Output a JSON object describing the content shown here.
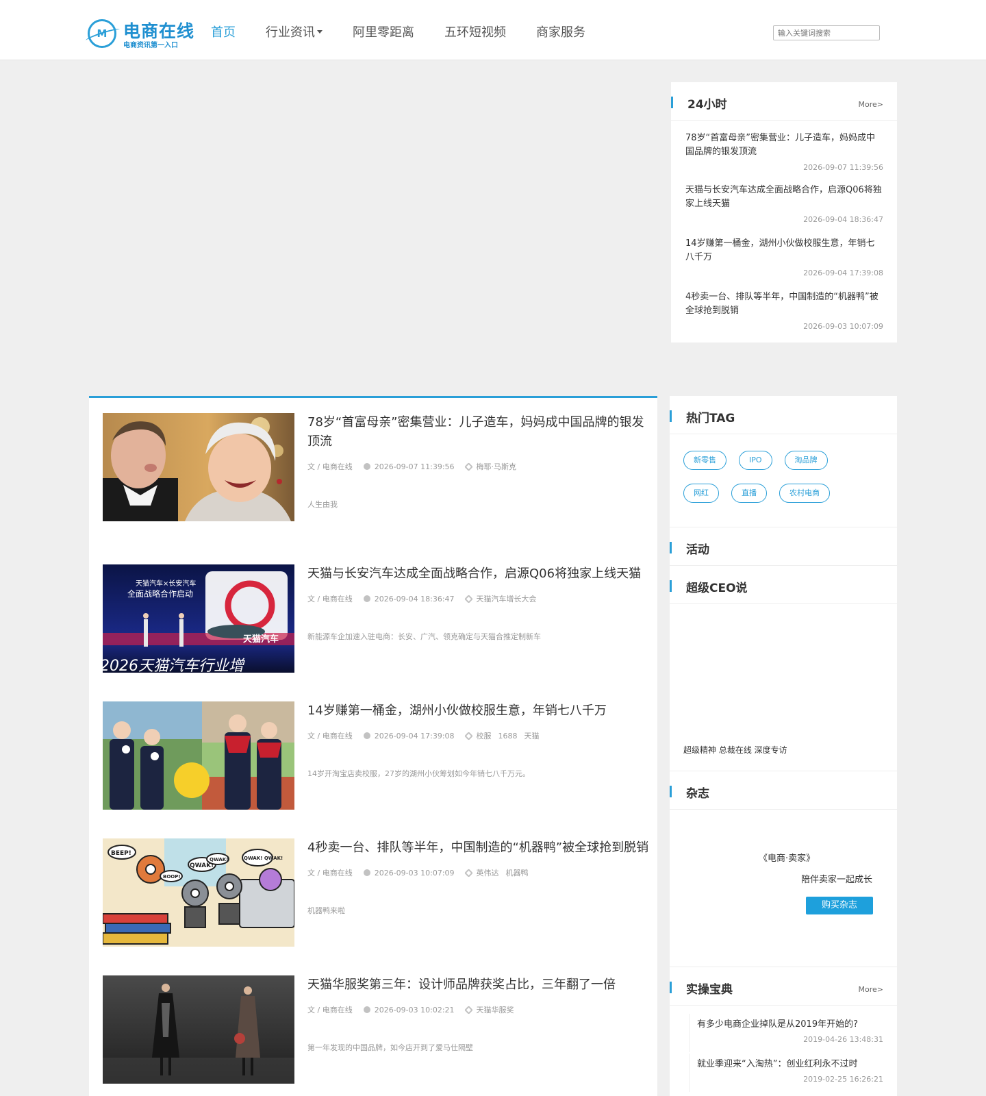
{
  "header": {
    "logo_name": "电商在线",
    "logo_slogan": "电商资讯第一入口",
    "logo_mark": "M",
    "nav": [
      {
        "label": "首页",
        "active": true
      },
      {
        "label": "行业资讯",
        "dropdown": true
      },
      {
        "label": "阿里零距离"
      },
      {
        "label": "五环短视频"
      },
      {
        "label": "商家服务"
      }
    ],
    "search_placeholder": "输入关键词搜索"
  },
  "hours24": {
    "title": "24小时",
    "more": "More>",
    "items": [
      {
        "title": "78岁“首富母亲”密集营业：儿子造车，妈妈成中国品牌的银发顶流",
        "time": "2026-09-07 11:39:56"
      },
      {
        "title": "天猫与长安汽车达成全面战略合作，启源Q06将独家上线天猫",
        "time": "2026-09-04 18:36:47"
      },
      {
        "title": "14岁赚第一桶金，湖州小伙做校服生意，年销七八千万",
        "time": "2026-09-04 17:39:08"
      },
      {
        "title": "4秒卖一台、排队等半年，中国制造的“机器鸭”被全球抢到脱销",
        "time": "2026-09-03 10:07:09"
      }
    ]
  },
  "articles": [
    {
      "title": "78岁“首富母亲”密集营业：儿子造车，妈妈成中国品牌的银发顶流",
      "author": "文 / 电商在线",
      "time": "2026-09-07 11:39:56",
      "tags": [
        "梅耶·马斯克"
      ],
      "summary": "人生由我"
    },
    {
      "title": "天猫与长安汽车达成全面战略合作，启源Q06将独家上线天猫",
      "author": "文 / 电商在线",
      "time": "2026-09-04 18:36:47",
      "tags": [
        "天猫汽车增长大会"
      ],
      "summary": "新能源车企加速入驻电商：长安、广汽、领克确定与天猫合推定制新车",
      "banner_line1": "天猫汽车×长安汽车",
      "banner_line2": "全面战略合作启动",
      "banner_logo": "天猫汽车",
      "banner_bottom": "2026天猫汽车行业增"
    },
    {
      "title": "14岁赚第一桶金，湖州小伙做校服生意，年销七八千万",
      "author": "文 / 电商在线",
      "time": "2026-09-04 17:39:08",
      "tags": [
        "校服",
        "1688",
        "天猫"
      ],
      "summary": "14岁开淘宝店卖校服，27岁的湖州小伙筹划如今年销七八千万元。"
    },
    {
      "title": "4秒卖一台、排队等半年，中国制造的“机器鸭”被全球抢到脱销",
      "author": "文 / 电商在线",
      "time": "2026-09-03 10:07:09",
      "tags": [
        "英伟达",
        "机器鸭"
      ],
      "summary": "机器鸭来啦",
      "bubbles": [
        "BEEP!",
        "QWAK!",
        "BOOP!",
        "QWAK!",
        "QWAK! QWAK!"
      ]
    },
    {
      "title": "天猫华服奖第三年：设计师品牌获奖占比，三年翻了一倍",
      "author": "文 / 电商在线",
      "time": "2026-09-03 10:02:21",
      "tags": [
        "天猫华服奖"
      ],
      "summary": "第一年发现的中国品牌，如今店开到了爱马仕隔壁"
    }
  ],
  "hot_tags": {
    "title": "热门TAG",
    "tags": [
      "新零售",
      "IPO",
      "淘品牌",
      "网红",
      "直播",
      "农村电商"
    ]
  },
  "activity": {
    "title": "活动"
  },
  "ceo": {
    "title": "超级CEO说",
    "caption": "超级精神 总裁在线 深度专访"
  },
  "magazine": {
    "title": "杂志",
    "name": "《电商·卖家》",
    "subtitle": "陪伴卖家一起成长",
    "button": "购买杂志"
  },
  "practice": {
    "title": "实操宝典",
    "more": "More>",
    "items": [
      {
        "title": "有多少电商企业掉队是从2019年开始的?",
        "time": "2019-04-26 13:48:31"
      },
      {
        "title": "就业季迎来“入淘热”：创业红利永不过时",
        "time": "2019-02-25 16:26:21"
      }
    ]
  },
  "colors": {
    "accent": "#2a9fd8",
    "background": "#efefef",
    "button": "#1ea0dc"
  }
}
